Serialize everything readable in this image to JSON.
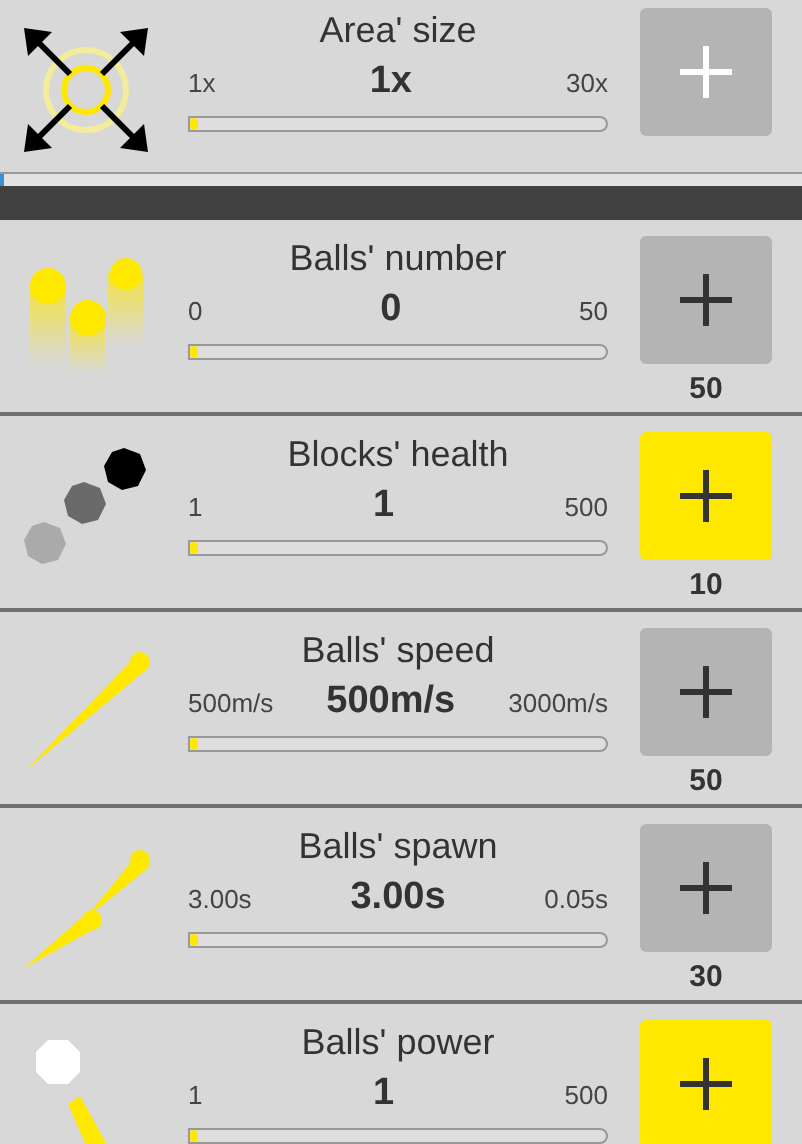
{
  "rows": [
    {
      "kind": "area",
      "title": "Area' size",
      "min": "1x",
      "value": "1x",
      "max": "30x",
      "level": 0,
      "button": {
        "kind": "maxed"
      }
    },
    {
      "kind": "progress",
      "level": 0.005
    },
    {
      "kind": "balls",
      "title": "Balls' number",
      "min": "0",
      "value": "0",
      "max": "50",
      "level": 0,
      "button": {
        "kind": "locked"
      },
      "cost": "50"
    },
    {
      "kind": "health",
      "title": "Blocks' health",
      "min": "1",
      "value": "1",
      "max": "500",
      "level": 0,
      "button": {
        "kind": "affordable"
      },
      "cost": "10"
    },
    {
      "kind": "speed",
      "title": "Balls' speed",
      "min": "500m/s",
      "value": "500m/s",
      "max": "3000m/s",
      "level": 0,
      "button": {
        "kind": "locked"
      },
      "cost": "50"
    },
    {
      "kind": "spawn",
      "title": "Balls' spawn",
      "min": "3.00s",
      "value": "3.00s",
      "max": "0.05s",
      "level": 0,
      "button": {
        "kind": "locked"
      },
      "cost": "30"
    },
    {
      "kind": "power",
      "title": "Balls' power",
      "min": "1",
      "value": "1",
      "max": "500",
      "level": 0,
      "button": {
        "kind": "affordable"
      }
    }
  ]
}
